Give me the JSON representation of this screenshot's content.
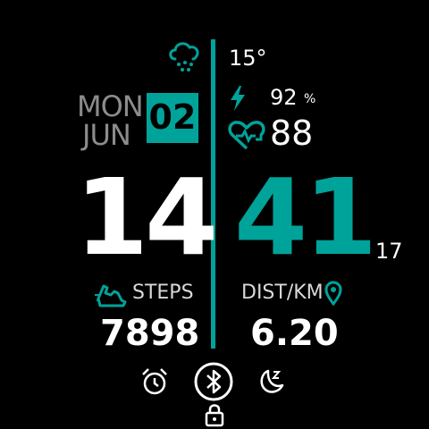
{
  "weather": {
    "icon": "cloud-snow-icon",
    "temperature": "15°"
  },
  "date": {
    "day_of_week": "MON",
    "month": "JUN",
    "day": "02"
  },
  "battery": {
    "icon": "bolt-icon",
    "value": "92",
    "unit": "%"
  },
  "heart": {
    "icon": "heart-rate-icon",
    "value": "88"
  },
  "time": {
    "hours": "14",
    "minutes": "41",
    "seconds": "17"
  },
  "steps": {
    "icon": "running-shoe-icon",
    "label": "STEPS",
    "value": "7898"
  },
  "distance": {
    "icon": "location-pin-icon",
    "label": "DIST/KM",
    "value": "6.20"
  },
  "status_icons": [
    "alarm-clock-icon",
    "bluetooth-icon",
    "moon-sleep-icon",
    "lock-icon"
  ],
  "colors": {
    "accent": "#00a39a",
    "background": "#000000",
    "text": "#ffffff",
    "muted": "#8c8c8c"
  }
}
